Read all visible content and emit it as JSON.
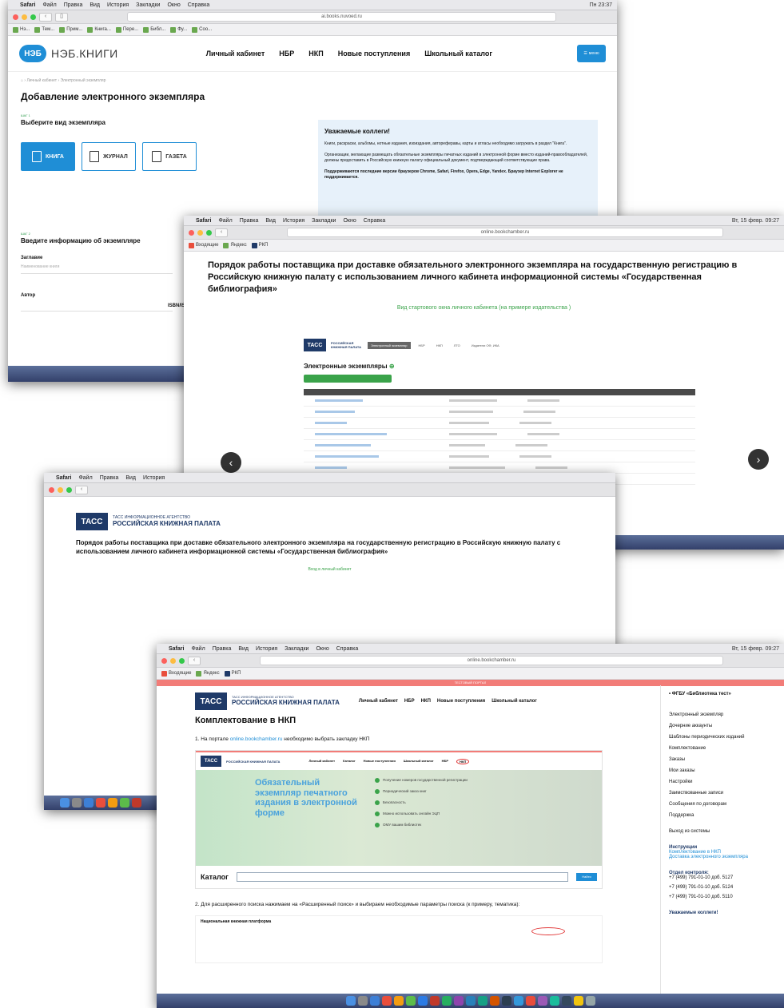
{
  "w1": {
    "menubar": {
      "apple": "",
      "app": "Safari",
      "items": [
        "Файл",
        "Правка",
        "Вид",
        "История",
        "Закладки",
        "Окно",
        "Справка"
      ],
      "status": "Пн 23:37"
    },
    "url": "ai.books.nuvoed.ru",
    "header": {
      "logo": "НЭБ",
      "name": "НЭБ.КНИГИ",
      "nav": [
        "Личный кабинет",
        "НБР",
        "НКП",
        "Новые поступления",
        "Школьный каталог"
      ],
      "menu_label": "меню"
    },
    "page_title": "Добавление электронного экземпляра",
    "step1": "ШАГ 1",
    "choose_kind": "Выберите вид экземпляра",
    "kinds": [
      "КНИГА",
      "ЖУРНАЛ",
      "ГАЗЕТА"
    ],
    "notice": {
      "title": "Уважаемые коллеги!",
      "p1": "Книги, раскраски, альбомы, нотные издания, изоиздания, автореферавы, карты и атласы необходимо загружать в раздел \"Книга\".",
      "p2": "Организации, желающие размещать обязательные экземпляры печатных изданий в электронной форме вместо изданий-правообладателей, должны предоставить в Российскую книжную палату официальный документ, подтверждающий соответствующие права.",
      "p3": "Поддерживаются последние версии браузеров Chrome, Safari, Firefox, Opera, Edge, Yandex. Браузер Internet Explorer не поддерживается."
    },
    "step2": "ШАГ 2",
    "enter_info": "Введите информацию об экземпляре",
    "title_label": "Заглавие",
    "title_placeholder": "Наименование книги",
    "author_label": "Автор",
    "isbn_label": "ISBN/ISSN"
  },
  "w2": {
    "menubar": {
      "app": "Safari",
      "items": [
        "Файл",
        "Правка",
        "Вид",
        "История",
        "Закладки",
        "Окно",
        "Справка"
      ],
      "status": "Вт, 15 февр. 09:27"
    },
    "url": "online.bookchamber.ru",
    "title": "Порядок работы поставщика при доставке обязательного электронного экземпляра на государственную регистрацию в Российскую книжную палату с использованием личного кабинета информационной системы «Государственная библиография»",
    "subtitle": "Вид стартового окна личного кабинета (на примере издательства )",
    "tass": "ТАСС",
    "rkp": "РОССИЙСКАЯ КНИЖНАЯ ПАЛАТА",
    "tabs": [
      "Электронный экземпляр",
      "НБР",
      "НКП",
      "ЛТО",
      "Издатели ОФ, ИКА"
    ],
    "section": "Электронные экземпляры",
    "prev": "‹",
    "next": "›"
  },
  "w3": {
    "menubar": {
      "app": "Safari",
      "items": [
        "Файл",
        "Правка",
        "Вид",
        "История"
      ]
    },
    "tass": "ТАСС",
    "agency": "ТАСС ИНФОРМАЦИОННОЕ АГЕНТСТВО",
    "rkp": "РОССИЙСКАЯ КНИЖНАЯ ПАЛАТА",
    "title": "Порядок работы поставщика при доставке обязательного электронного экземпляра на государственную регистрацию в Российскую книжную палату с использованием личного кабинета информационной системы «Государственная библиография»",
    "subtitle": "Вход в личный кабинет"
  },
  "w4": {
    "menubar": {
      "app": "Safari",
      "items": [
        "Файл",
        "Правка",
        "Вид",
        "История",
        "Закладки",
        "Окно",
        "Справка"
      ],
      "status": "Вт, 15 февр. 09:27"
    },
    "url": "online.bookchamber.ru",
    "banner": "ТЕСТОВЫЙ ПОРТАЛ",
    "tass": "ТАСС",
    "agency": "ТАСС ИНФОРМАЦИОННОЕ АГЕНТСТВО",
    "rkp": "РОССИЙСКАЯ КНИЖНАЯ ПАЛАТА",
    "nav": [
      "Личный кабинет",
      "НБР",
      "НКП",
      "Новые поступления",
      "Школьный каталог"
    ],
    "heading": "Комплектование в НКП",
    "p1_prefix": "1. На портале ",
    "p1_link": "online.bookchamber.ru",
    "p1_suffix": " необходимо выбрать закладку НКП",
    "mini_nav": [
      "Личный кабинет",
      "Каталог",
      "Новые поступления",
      "Школьный каталог",
      "НБР",
      "НКП"
    ],
    "hero_big": "Обязательный экземпляр печатного издания в электронной форме",
    "hero_items": [
      "Получение номеров государственной регистрации",
      "Периодический заказ книг",
      "Безопасность",
      "Можно использовать онлайн ЭЦП",
      "ОМУ вашим библиотек"
    ],
    "catalog": "Каталог",
    "search_btn": "Найти",
    "p2": "2. Для расширенного поиска нажимаем на «Расширенный поиск» и выбираем необходимые параметры поиска (к примеру, тематика):",
    "platform": "Национальная книжная платформа",
    "sidebar": {
      "org": "ФГБУ «Библиотека тест»",
      "items": [
        "Электронный экземпляр",
        "Дочерние аккаунты",
        "Шаблоны периодических изданий",
        "Комплектование",
        "Заказы",
        "Мои заказы",
        "Настройки",
        "Заимствованные записи",
        "Сообщения по договорам",
        "Поддержка"
      ],
      "logout": "Выход из системы",
      "instr_title": "Инструкции",
      "instr_links": [
        "Комплектование в НКП",
        "Доставка электронного экземпляра"
      ],
      "control_title": "Отдел контроля:",
      "phones": [
        "+7 (499) 791-01-10 доб. 5127",
        "+7 (499) 791-01-10 доб. 5124",
        "+7 (499) 791-01-10 доб. 5110"
      ],
      "colleagues": "Уважаемые коллеги!"
    }
  },
  "colors": {
    "neb_blue": "#1f8ed6",
    "tass_navy": "#1f3a68",
    "green": "#3aa34a",
    "red_accent": "#e03030"
  }
}
